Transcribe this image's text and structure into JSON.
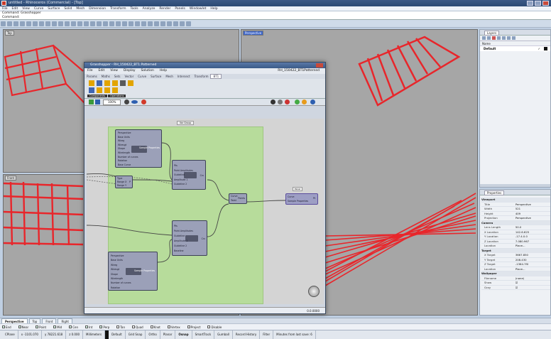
{
  "window": {
    "title": "untitled - Rhinoceros (Commercial) - [Top]"
  },
  "menu": [
    "File",
    "Edit",
    "View",
    "Curve",
    "Surface",
    "Solid",
    "Mesh",
    "Dimension",
    "Transform",
    "Tools",
    "Analyze",
    "Render",
    "Panels",
    "Windowlet",
    "Help"
  ],
  "command": {
    "history": "Command: Grasshopper",
    "prompt": "Command:"
  },
  "viewports": {
    "top": "Top",
    "perspective": "Perspective",
    "front": "Front"
  },
  "grasshopper": {
    "title": "Grasshopper - RH_150422_BT1.Patterned",
    "doc_name": "RH_150422_BT1Patterned",
    "menu": [
      "File",
      "Edit",
      "View",
      "Display",
      "Solution",
      "Help"
    ],
    "tabs": [
      "Params",
      "Maths",
      "Sets",
      "Vector",
      "Curve",
      "Surface",
      "Mesh",
      "Intersect",
      "Transform",
      "BT1"
    ],
    "ribbon_groups": [
      "Components",
      "Operations"
    ],
    "zoom": "100%",
    "status": "0.0.0000",
    "components": {
      "a": {
        "inputs": [
          "Perspective",
          "Base Units",
          "Wireg",
          "Wiresgt",
          "Shape",
          "Wirelength",
          "Number of curves",
          "Rotation",
          "Base Curve"
        ],
        "output": "Sample Properties"
      },
      "b": {
        "inputs": [
          "Type",
          "Range X",
          "Range Y"
        ],
        "output": "P"
      },
      "c": {
        "inputs": [
          "Pts",
          "Point Amplitudes",
          "Guideline",
          "Amplitude 1",
          "Guideline 2"
        ],
        "output": "Crv"
      },
      "d": {
        "inputs": [
          "Curve",
          "Twist"
        ],
        "output": "Points"
      },
      "e": {
        "inputs": [
          "Pts",
          "Point Amplitudes",
          "Guideline",
          "Amplitude 1",
          "Guideline 2",
          "Baseline"
        ],
        "output": "Crv"
      },
      "f": {
        "inputs": [
          "Perspective",
          "Base Units",
          "Wireg",
          "Wiresgt",
          "Shape",
          "Wirelength",
          "Number of curves",
          "Rotation"
        ],
        "output": "Sample Properties"
      },
      "g": {
        "inputs": [
          "Curve",
          "Sample Properties"
        ],
        "output": "Pt"
      },
      "label_top": "Var Group",
      "label_right": "Panel"
    }
  },
  "layers_panel": {
    "tab": "Layers",
    "header_name": "Name",
    "default_layer": "Default"
  },
  "properties_panel": {
    "tab": "Properties",
    "sections": [
      {
        "title": "Viewport",
        "rows": [
          [
            "Title",
            "Perspective"
          ],
          [
            "Width",
            "521"
          ],
          [
            "Height",
            "409"
          ],
          [
            "Projection",
            "Perspective"
          ]
        ]
      },
      {
        "title": "Camera",
        "rows": [
          [
            "Lens Length",
            "50.0"
          ],
          [
            "X Location",
            "142.6.625"
          ],
          [
            "Y Location",
            "-17.4.0.0"
          ],
          [
            "Z Location",
            "7.080.967"
          ],
          [
            "Location",
            "Place..."
          ]
        ]
      },
      {
        "title": "Target",
        "rows": [
          [
            "X Target",
            "3667.850"
          ],
          [
            "Y Target",
            "208.430"
          ],
          [
            "Z Target",
            "-1364.7f0"
          ],
          [
            "Location",
            "Place..."
          ]
        ]
      },
      {
        "title": "Wallpaper",
        "rows": [
          [
            "Filename",
            "(none)"
          ],
          [
            "Show",
            "☑"
          ],
          [
            "Gray",
            "☑"
          ]
        ]
      }
    ]
  },
  "bottom_tabs": [
    "Perspective",
    "Top",
    "Front",
    "Right"
  ],
  "osnaps": [
    "End",
    "Near",
    "Point",
    "Mid",
    "Cen",
    "Int",
    "Perp",
    "Tan",
    "Quad",
    "Knot",
    "Vertex",
    "Project",
    "Disable"
  ],
  "statusbar": [
    "CPlane",
    "x -1101.070",
    "y 78221.618",
    "z 0.000",
    "Millimeters",
    "Default",
    "Grid Snap",
    "Ortho",
    "Planar",
    "Osnap",
    "SmartTrack",
    "Gumball",
    "Record History",
    "Filter",
    "Minutes from last save: 6"
  ],
  "colors": {
    "model_red": "#e8262b",
    "viewport_gray": "#a6a6a6",
    "gh_group": "#b7dc9b",
    "gh_component": "#9ba0b8"
  }
}
